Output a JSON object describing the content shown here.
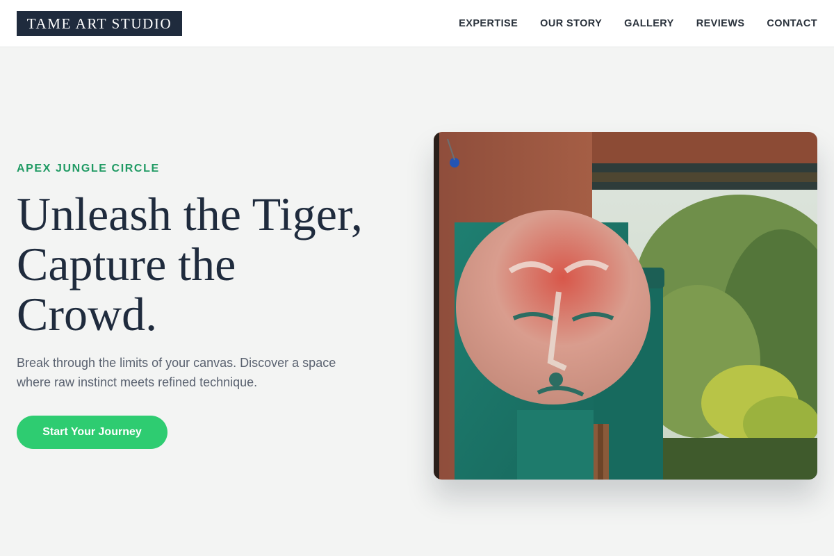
{
  "header": {
    "logo": "TAME ART STUDIO",
    "nav": [
      "EXPERTISE",
      "OUR STORY",
      "GALLERY",
      "REVIEWS",
      "CONTACT"
    ]
  },
  "hero": {
    "eyebrow": "APEX JUNGLE CIRCLE",
    "title_lines": [
      "Unleash the Tiger,",
      "Capture the",
      "Crowd."
    ],
    "subtitle": "Break through the limits of your canvas. Discover a space where raw instinct meets refined technique.",
    "cta_label": "Start Your Journey"
  },
  "colors": {
    "accent_green": "#2ecc71",
    "eyebrow_green": "#1f9a63",
    "logo_bg": "#1f2b3d",
    "page_bg": "#f3f4f3"
  }
}
